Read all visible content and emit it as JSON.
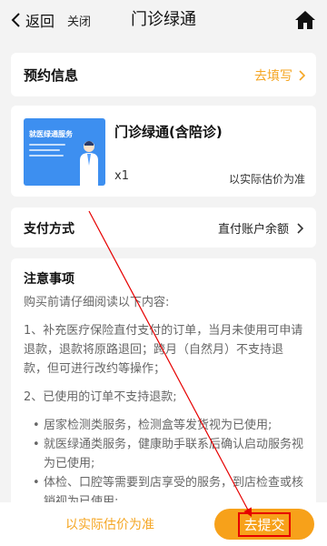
{
  "nav": {
    "back_label": "返回",
    "close_label": "关闭",
    "title": "门诊绿通",
    "home_icon": "home-icon",
    "back_icon": "chevron-left-icon"
  },
  "appointment": {
    "label": "预约信息",
    "action_label": "去填写",
    "action_icon": "chevron-right-icon"
  },
  "product": {
    "thumb_title": "就医绿通服务",
    "name": "门诊绿通(含陪诊)",
    "quantity": "x1",
    "price_note": "以实际估价为准"
  },
  "payment": {
    "label": "支付方式",
    "value": "直付账户余额"
  },
  "notes": {
    "title": "注意事项",
    "intro": "购买前请仔细阅读以下内容:",
    "item1": "1、补充医疗保险直付支付的订单，当月未使用可申请退款，退款将原路退回；跨月（自然月）不支持退款，但可进行改约等操作；",
    "item2": "2、已使用的订单不支持退款;",
    "bullets": [
      "居家检测类服务，检测盒等发货视为已使用;",
      "就医绿通类服务，健康助手联系后确认启动服务视为已使用;",
      "体检、口腔等需要到店享受的服务，到店检查或核销视为已使用;"
    ]
  },
  "bottom": {
    "estimate_label": "以实际估价为准",
    "submit_label": "去提交"
  },
  "colors": {
    "accent": "#f5a623",
    "submit_bg": "#f7a11a",
    "annotation": "#e60000"
  }
}
